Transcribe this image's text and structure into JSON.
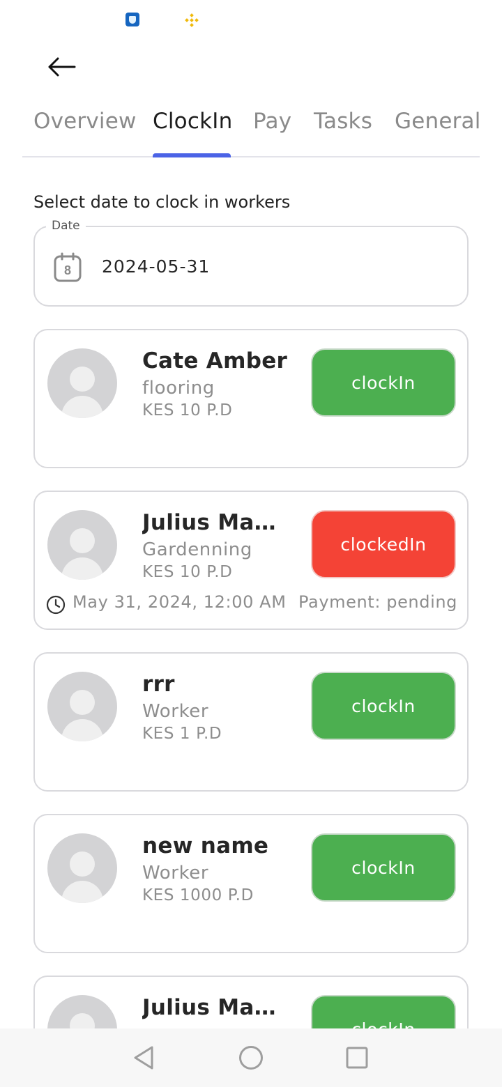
{
  "status_bar": {
    "icons": [
      "shield-app-icon",
      "binance-icon"
    ]
  },
  "app_bar": {
    "back_icon": "arrow-left-icon"
  },
  "tabs": [
    {
      "label": "Overview",
      "active": false
    },
    {
      "label": "ClockIn",
      "active": true
    },
    {
      "label": "Pay",
      "active": false
    },
    {
      "label": "Tasks",
      "active": false
    },
    {
      "label": "General",
      "active": false
    }
  ],
  "prompt": "Select date to clock in workers",
  "date_field": {
    "label": "Date",
    "value": "2024-05-31",
    "icon": "calendar-icon",
    "icon_day": "8"
  },
  "workers": [
    {
      "name": "Cate Amber",
      "role": "flooring",
      "rate": "KES 10 P.D",
      "button": "clockIn",
      "state": "not-clocked"
    },
    {
      "name": "Julius Mam...",
      "role": "Gardenning",
      "rate": "KES 10 P.D",
      "button": "clockedIn",
      "state": "clocked",
      "time": "May 31, 2024, 12:00 AM",
      "payment": "Payment: pending"
    },
    {
      "name": "rrr",
      "role": "Worker",
      "rate": "KES 1 P.D",
      "button": "clockIn",
      "state": "not-clocked"
    },
    {
      "name": "new name",
      "role": "Worker",
      "rate": "KES 1000 P.D",
      "button": "clockIn",
      "state": "not-clocked"
    },
    {
      "name": "Julius Mam...",
      "role": "",
      "rate": "",
      "button": "clockIn",
      "state": "not-clocked"
    }
  ],
  "colors": {
    "accent": "#4b63e6",
    "clock_in": "#4caf50",
    "clocked_in": "#f44336"
  },
  "nav_bar": {
    "buttons": [
      "back-triangle-icon",
      "home-circle-icon",
      "recents-square-icon"
    ]
  }
}
